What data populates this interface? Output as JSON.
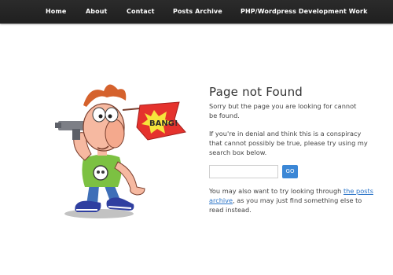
{
  "nav": {
    "items": [
      {
        "label": "Home"
      },
      {
        "label": "About"
      },
      {
        "label": "Contact"
      },
      {
        "label": "Posts Archive"
      },
      {
        "label": "PHP/Wordpress Development Work"
      }
    ]
  },
  "illustration": {
    "flag_text": "BANG!"
  },
  "main": {
    "title": "Page not Found",
    "para1": "Sorry but the page you are looking for cannot be found.",
    "para2": "If you're in denial and think this is a conspiracy that cannot possibly be true, please try using my search box below.",
    "search": {
      "placeholder": "",
      "value": "",
      "button_label": "GO"
    },
    "para3_before": "You may also want to try looking through ",
    "para3_link": "the posts archive",
    "para3_after": ", as you may just find something else to read instead."
  },
  "colors": {
    "navbar": "#242424",
    "nav_text": "#ffffff",
    "accent": "#3b87d6",
    "link": "#2a74c8",
    "text": "#444444"
  }
}
